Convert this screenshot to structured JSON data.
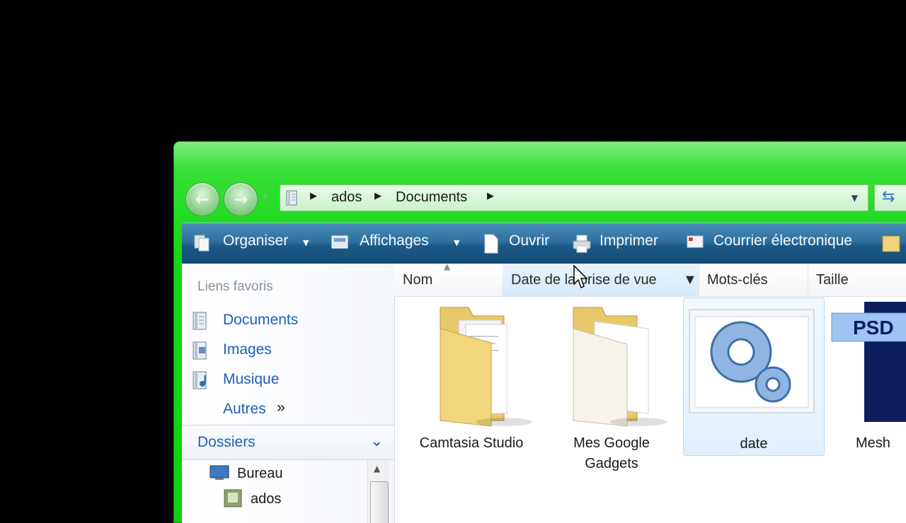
{
  "navigation": {
    "back_icon": "back-arrow-icon",
    "forward_icon": "forward-arrow-icon"
  },
  "address_bar": {
    "crumbs": [
      "ados",
      "Documents"
    ]
  },
  "toolbar": {
    "organize": "Organiser",
    "views": "Affichages",
    "open": "Ouvrir",
    "print": "Imprimer",
    "email": "Courrier électronique"
  },
  "sidebar": {
    "favorites_title": "Liens favoris",
    "favorites": [
      {
        "label": "Documents",
        "icon": "documents-icon"
      },
      {
        "label": "Images",
        "icon": "images-icon"
      },
      {
        "label": "Musique",
        "icon": "music-icon"
      }
    ],
    "more": "Autres",
    "more_glyph": "»",
    "folders_title": "Dossiers",
    "tree": [
      "Bureau",
      "ados"
    ]
  },
  "columns": [
    "Nom",
    "Date de la prise de vue",
    "Mots-clés",
    "Taille"
  ],
  "items": [
    {
      "label_lines": [
        "Camtasia Studio"
      ],
      "icon": "folder-icon"
    },
    {
      "label_lines": [
        "Mes Google",
        "Gadgets"
      ],
      "icon": "folder-icon"
    },
    {
      "label_lines": [
        "date"
      ],
      "icon": "application-gears-icon",
      "selected": true
    },
    {
      "label_lines": [
        "Mesh"
      ],
      "icon": "psd-file-icon",
      "badge": "PSD"
    }
  ],
  "colors": {
    "window_frame": "#16d816",
    "toolbar": "#1b5a86",
    "link": "#1f5fb8"
  }
}
